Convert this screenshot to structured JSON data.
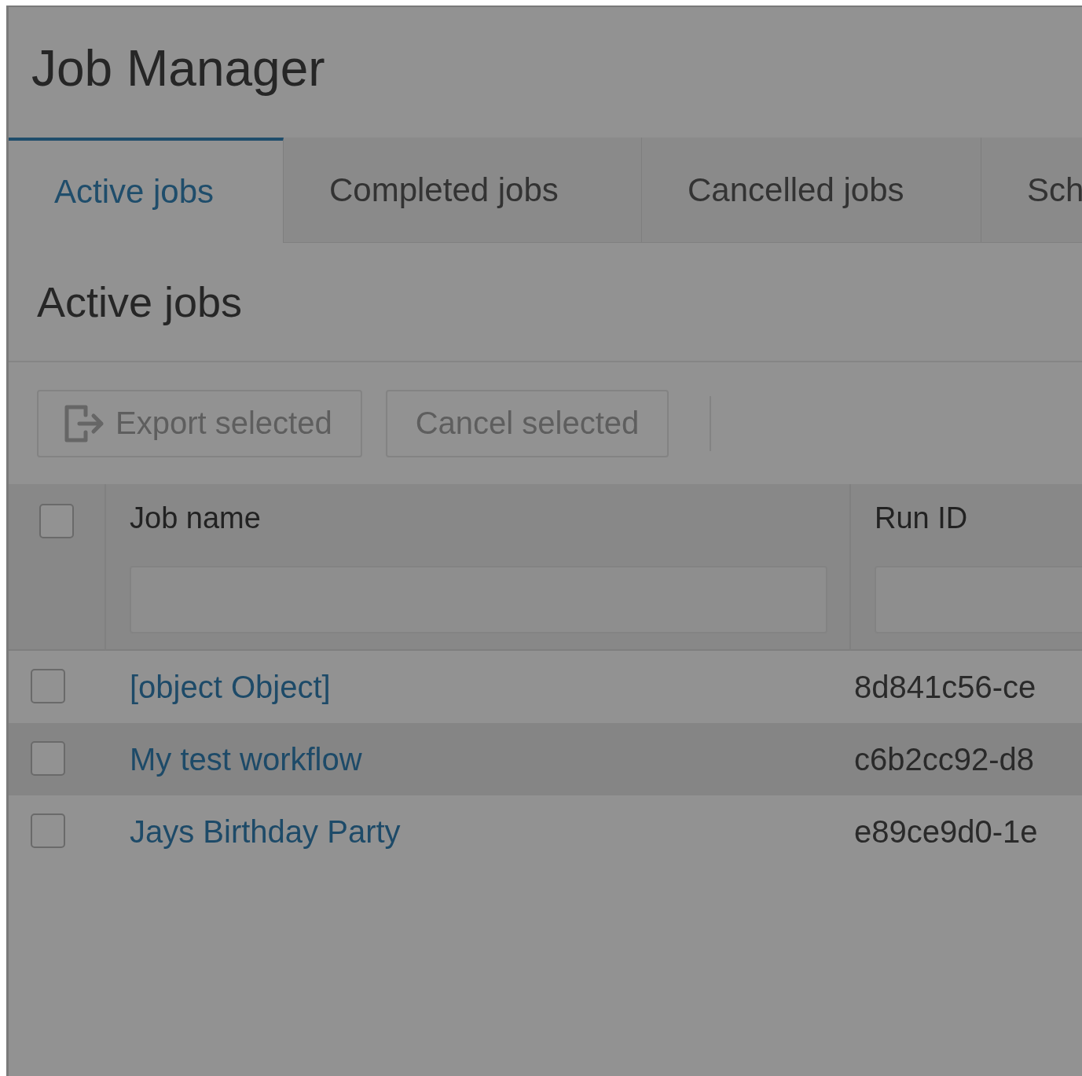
{
  "title": "Job Manager",
  "tabs": [
    {
      "label": "Active jobs",
      "selected": true
    },
    {
      "label": "Completed jobs",
      "selected": false
    },
    {
      "label": "Cancelled jobs",
      "selected": false
    },
    {
      "label": "Sch",
      "selected": false
    }
  ],
  "section_title": "Active jobs",
  "toolbar": [
    {
      "label": "Export selected",
      "kind": "icon"
    },
    {
      "label": "Cancel selected",
      "kind": "plain"
    }
  ],
  "table": {
    "select_all": {
      "checked": false
    },
    "columns": [
      "Job name",
      "Run ID"
    ],
    "rows": [
      {
        "checked": false,
        "highlighted": false,
        "job_name": "[object Object]",
        "run_id": "8d841c56-ce"
      },
      {
        "checked": false,
        "highlighted": true,
        "job_name": "My test workflow",
        "run_id": "c6b2cc92-d8"
      },
      {
        "checked": false,
        "highlighted": false,
        "job_name": "Jays Birthday Party",
        "run_id": "e89ce9d0-1e"
      }
    ]
  }
}
